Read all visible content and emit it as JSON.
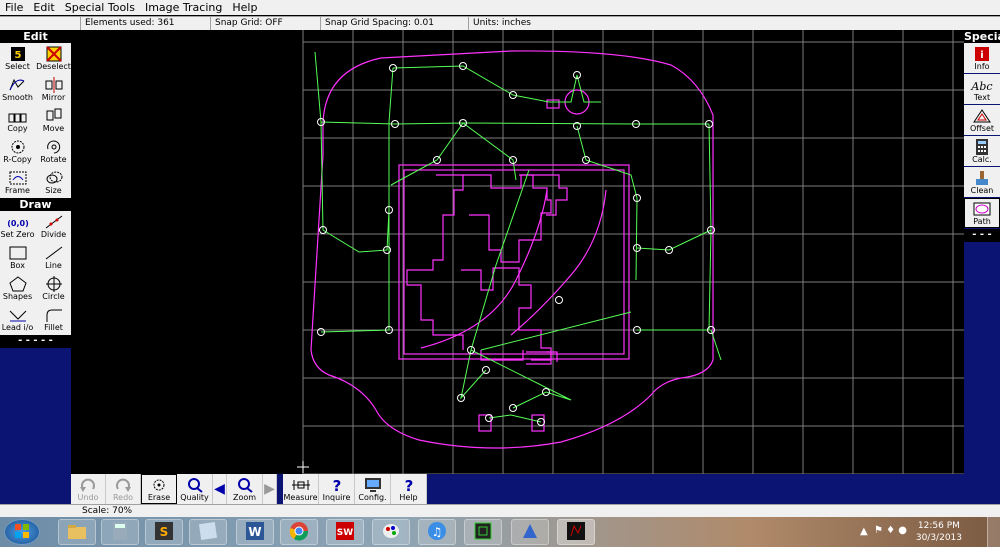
{
  "menu": [
    "File",
    "Edit",
    "Special Tools",
    "Image Tracing",
    "Help"
  ],
  "status": {
    "elements": "Elements used: 361",
    "snap_grid": "Snap Grid: OFF",
    "snap_spacing": "Snap Grid Spacing: 0.01",
    "units": "Units: inches"
  },
  "left_panel": {
    "edit_header": "Edit",
    "edit_tools": [
      "Select",
      "Deselect",
      "Smooth",
      "Mirror",
      "Copy",
      "Move",
      "R-Copy",
      "Rotate",
      "Frame",
      "Size"
    ],
    "draw_header": "Draw",
    "draw_tools": [
      "Set Zero",
      "Divide",
      "Box",
      "Line",
      "Shapes",
      "Circle",
      "Lead i/o",
      "Fillet"
    ],
    "dashes": "- - - - -"
  },
  "right_panel": {
    "header": "Special",
    "tools": [
      "Info",
      "Text",
      "Offset",
      "Calc.",
      "Clean",
      "Path"
    ],
    "dashes": "- - -"
  },
  "bottom_tools": [
    "Undo",
    "Redo",
    "Erase",
    "Quality",
    "Zoom",
    "Measure",
    "Inquire",
    "Config.",
    "Help"
  ],
  "scale": "Scale: 70%",
  "clock": {
    "time": "12:56 PM",
    "date": "30/3/2013"
  },
  "colors": {
    "panel": "#0b1473",
    "grid": "#7d7d7d",
    "magenta": "#ff33ff",
    "green": "#55ff55"
  }
}
